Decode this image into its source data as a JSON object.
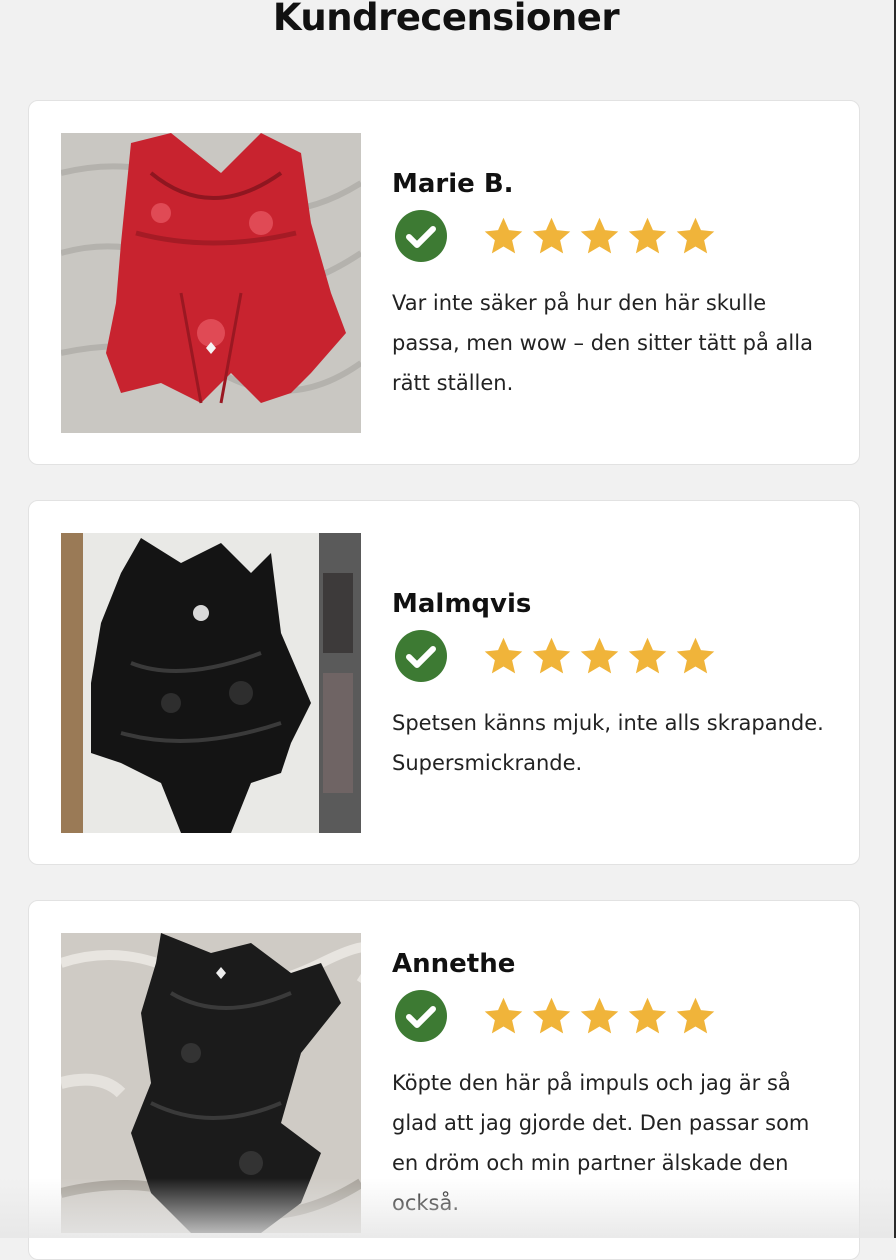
{
  "page": {
    "title": "Kundrecensioner"
  },
  "reviews": [
    {
      "name": "Marie B.",
      "rating": 5,
      "verified": true,
      "photo": "red-lace-bodysuit-photo",
      "text": "Var inte säker på hur den här skulle passa, men wow – den sitter tätt på alla rätt ställen."
    },
    {
      "name": "Malmqvis",
      "rating": 5,
      "verified": true,
      "photo": "black-lace-bodysuit-photo",
      "text": "Spetsen känns mjuk, inte alls skrapande. Supersmickrande."
    },
    {
      "name": "Annethe",
      "rating": 5,
      "verified": true,
      "photo": "black-lace-on-fur-photo",
      "text": "Köpte den här på impuls och jag är så glad att jag gjorde det. Den passar som en dröm och min partner älskade den också."
    }
  ],
  "colors": {
    "star": "#f0b43a",
    "verified": "#3d7a33",
    "background": "#f1f1f1"
  }
}
